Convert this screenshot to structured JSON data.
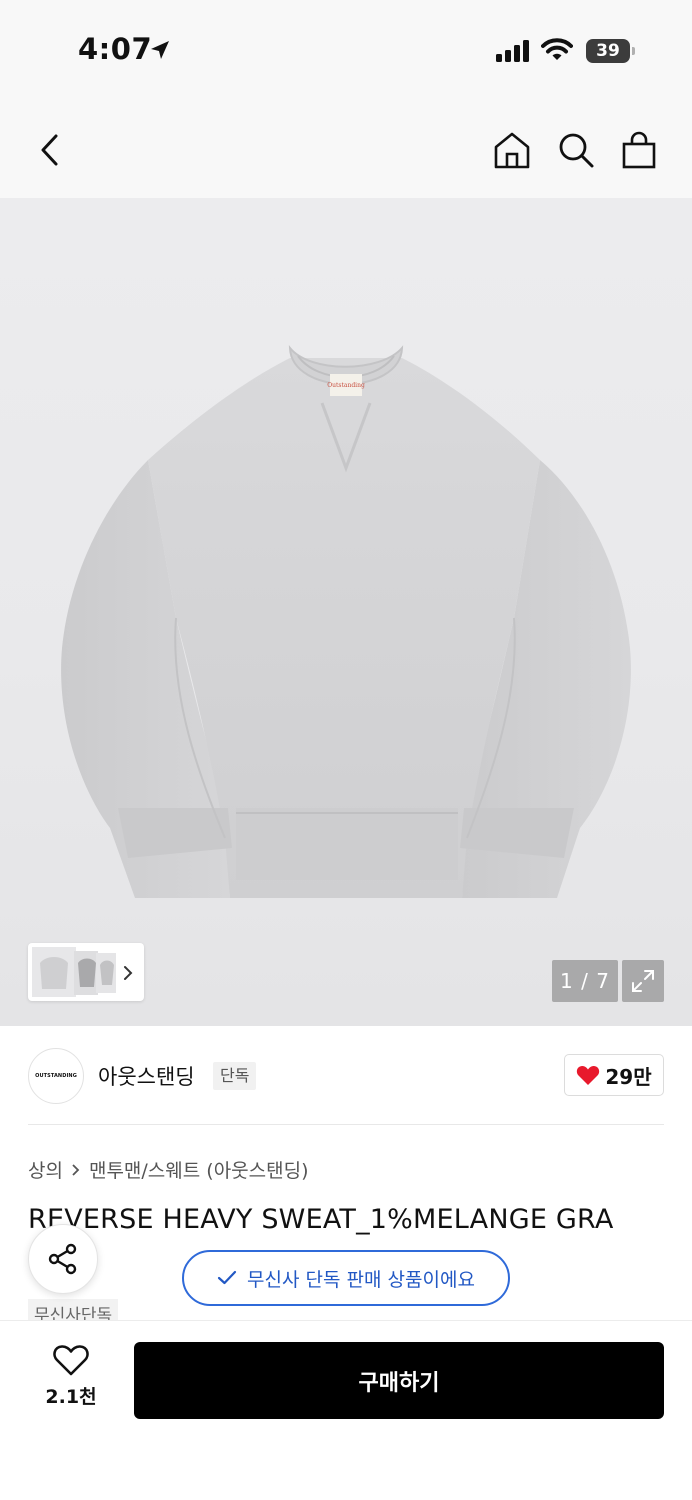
{
  "status_bar": {
    "time": "4:07",
    "battery": "39"
  },
  "nav": {
    "icons": [
      "back-icon",
      "home-icon",
      "search-icon",
      "shopping-bag-icon"
    ]
  },
  "gallery": {
    "counter": "1 / 7",
    "current_index": 1,
    "total": 7,
    "label_text": "Outstanding"
  },
  "brand": {
    "logo_text": "OUTSTANDING",
    "name": "아웃스탠딩",
    "badge": "단독",
    "like_count": "29만"
  },
  "product": {
    "breadcrumb": [
      "상의",
      "맨투맨/스웨트 (아웃스탠딩)"
    ],
    "title": "REVERSE HEAVY SWEAT_1%MELANGE GRA",
    "tag": "무신사단독"
  },
  "notice": {
    "exclusive_text": "무신사 단독 판매 상품이에요"
  },
  "bottom": {
    "wish_count": "2.1천",
    "buy_label": "구매하기"
  },
  "colors": {
    "accent_blue": "#2f6ad9",
    "heart_red": "#e8192c",
    "buy_button": "#000000"
  }
}
